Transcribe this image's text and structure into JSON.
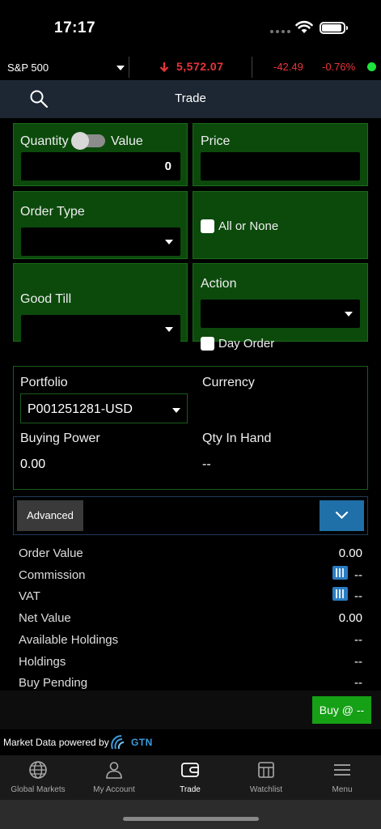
{
  "status": {
    "time": "17:17"
  },
  "ticker": {
    "index": "S&P 500",
    "last": "5,572.07",
    "change": "-42.49",
    "percent": "-0.76%"
  },
  "header": {
    "title": "Trade"
  },
  "form": {
    "quantity_label": "Quantity",
    "value_label": "Value",
    "quantity_value": "0",
    "price_label": "Price",
    "order_type_label": "Order Type",
    "all_or_none_label": "All or None",
    "good_till_label": "Good Till",
    "action_label": "Action",
    "day_order_label": "Day Order"
  },
  "portfolio": {
    "portfolio_label": "Portfolio",
    "portfolio_value": "P001251281-USD",
    "currency_label": "Currency",
    "buying_power_label": "Buying Power",
    "buying_power_value": "0.00",
    "qty_in_hand_label": "Qty In Hand",
    "qty_in_hand_value": "--"
  },
  "advanced": {
    "label": "Advanced"
  },
  "summary": [
    {
      "key": "Order Value",
      "value": "0.00"
    },
    {
      "key": "Commission",
      "value": "--"
    },
    {
      "key": "VAT",
      "value": "--"
    },
    {
      "key": "Net Value",
      "value": "0.00"
    },
    {
      "key": "Available Holdings",
      "value": "--"
    },
    {
      "key": "Holdings",
      "value": "--"
    },
    {
      "key": "Buy Pending",
      "value": "--"
    }
  ],
  "buy_button": {
    "label": "Buy @ --"
  },
  "powered_by": {
    "text": "Market Data powered by",
    "brand": "GTN"
  },
  "tabs": [
    {
      "label": "Global Markets",
      "icon": "globe-icon"
    },
    {
      "label": "My Account",
      "icon": "person-icon"
    },
    {
      "label": "Trade",
      "icon": "wallet-icon"
    },
    {
      "label": "Watchlist",
      "icon": "grid-icon"
    },
    {
      "label": "Menu",
      "icon": "hamburger-icon"
    }
  ],
  "colors": {
    "up_down_red": "#e8353b",
    "cell_green": "#0c4a0c",
    "buy_green": "#16a016",
    "accent_blue": "#1f6fa8"
  }
}
